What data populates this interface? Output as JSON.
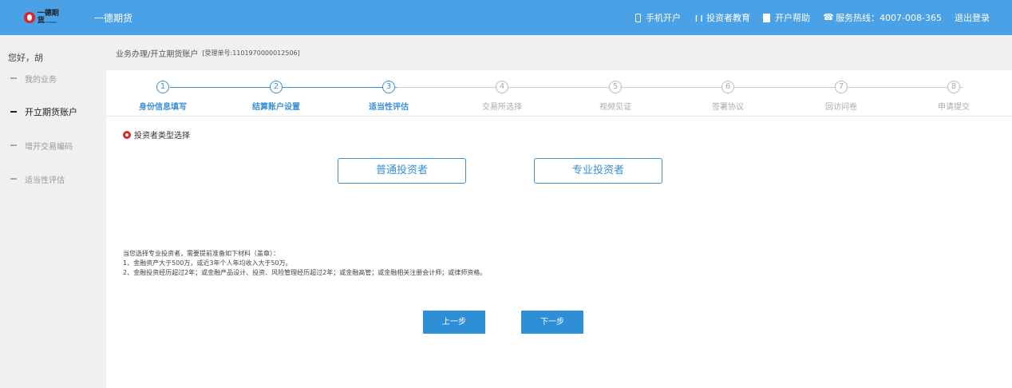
{
  "header": {
    "logo_text": "一德期货",
    "logo_subtext": "FIRST FUTURES",
    "brand": "一德期货",
    "links": [
      {
        "icon": "mobile-phone-icon",
        "label": "手机开户"
      },
      {
        "icon": "books-icon",
        "label": "投资者教育"
      },
      {
        "icon": "help-document-icon",
        "label": "开户帮助"
      },
      {
        "icon": "telephone-icon",
        "label": "服务热线：4007-008-365"
      },
      {
        "label": "退出登录"
      }
    ]
  },
  "sidebar": {
    "greeting": "您好，胡",
    "items": [
      {
        "label": "我的业务",
        "active": false
      },
      {
        "label": "开立期货账户",
        "active": true
      },
      {
        "label": "增开交易编码",
        "active": false
      },
      {
        "label": "适当性评估",
        "active": false
      }
    ]
  },
  "breadcrumb": {
    "path": "业务办理/开立期货账户",
    "accept_no": "[受理单号:1101970000012506]"
  },
  "steps": [
    {
      "num": "1",
      "label": "身份信息填写",
      "done": true
    },
    {
      "num": "2",
      "label": "结算账户设置",
      "done": true
    },
    {
      "num": "3",
      "label": "适当性评估",
      "done": true
    },
    {
      "num": "4",
      "label": "交易所选择",
      "done": false
    },
    {
      "num": "5",
      "label": "视频见证",
      "done": false
    },
    {
      "num": "6",
      "label": "签署协议",
      "done": false
    },
    {
      "num": "7",
      "label": "回访问卷",
      "done": false
    },
    {
      "num": "8",
      "label": "申请提交",
      "done": false
    }
  ],
  "section": {
    "title": "投资者类型选择"
  },
  "choices": {
    "normal": "普通投资者",
    "professional": "专业投资者"
  },
  "notes": [
    "当您选择专业投资者，需要提前准备如下材料（盖章）：",
    "1、金融资产大于500万，或近3年个人年均收入大于50万。",
    "2、金融投资经历超过2年；或金融产品设计、投资、风险管理经历超过2年；或金融高管；或金融相关注册会计师；或律师资格。"
  ],
  "buttons": {
    "prev": "上一步",
    "next": "下一步"
  },
  "colors": {
    "topbar": "#4aa1e5",
    "accent": "#3b8fd6",
    "button": "#2f8fd6",
    "bullet": "#d9262b"
  }
}
